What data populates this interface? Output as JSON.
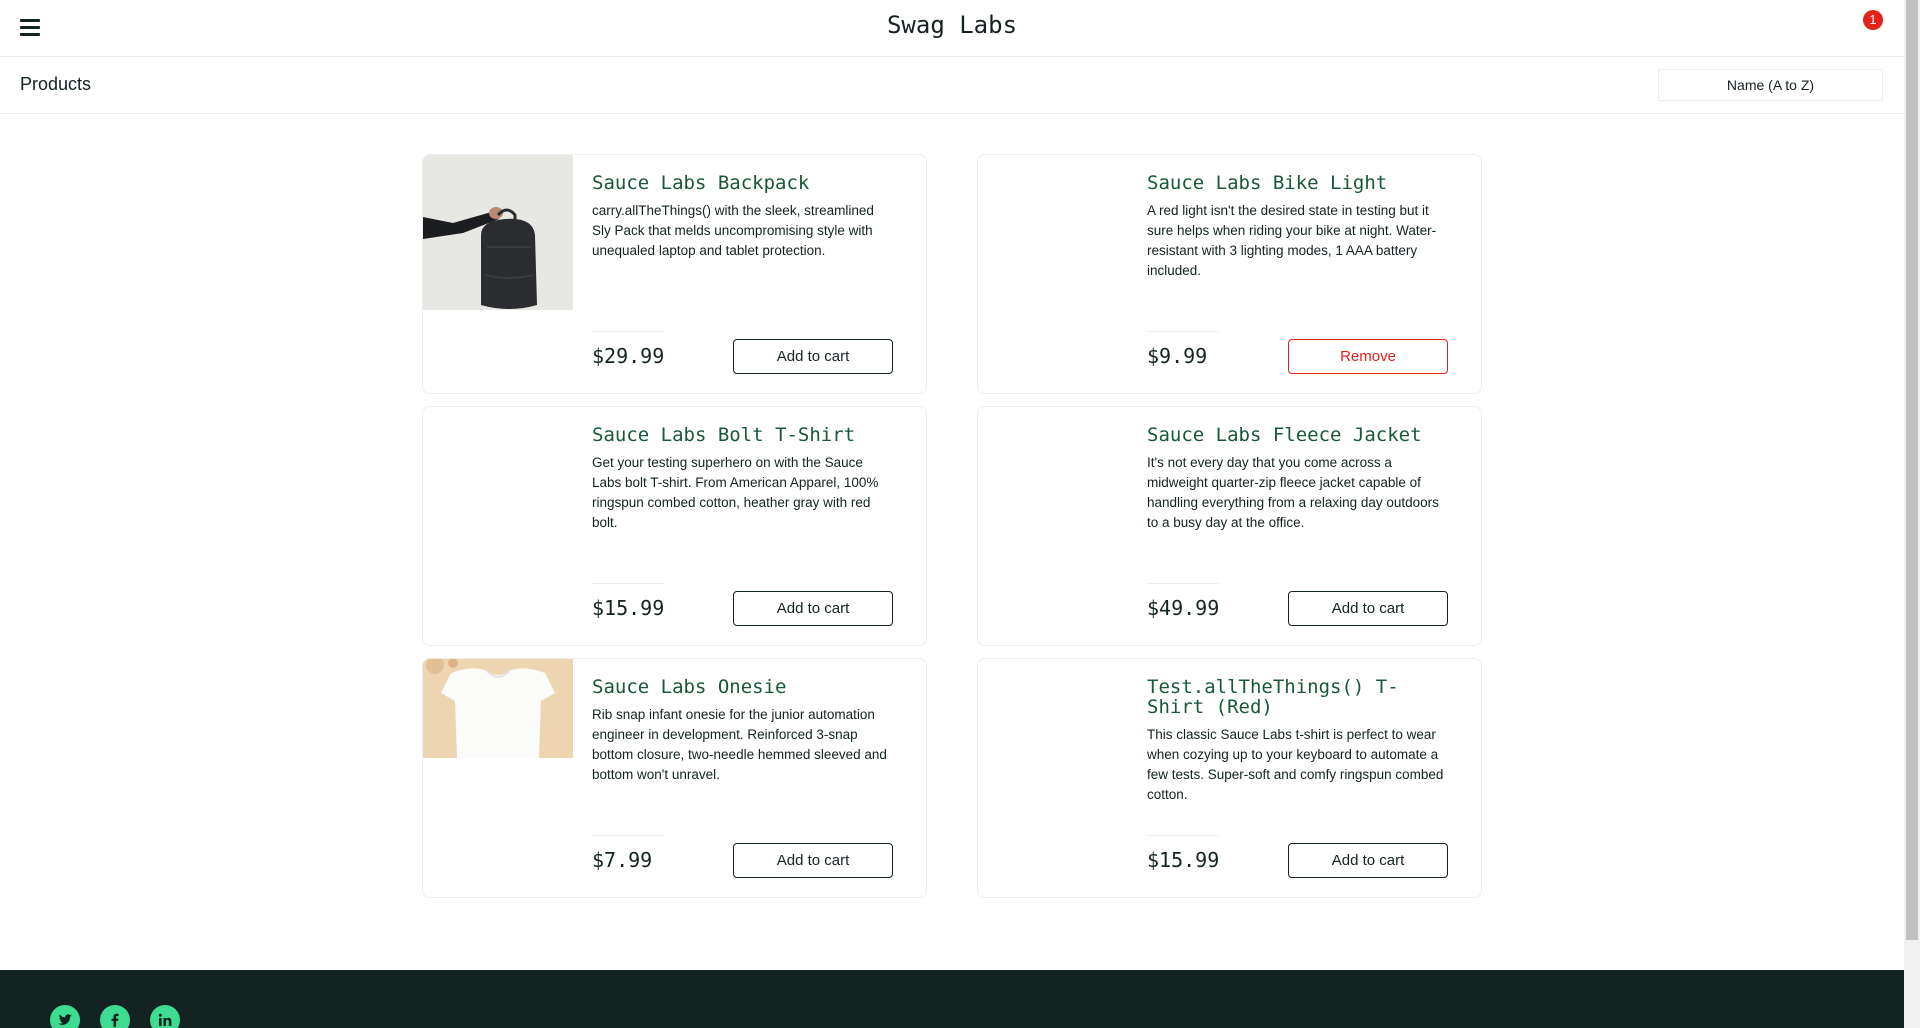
{
  "header": {
    "title": "Swag Labs",
    "cart_count": "1"
  },
  "secondary": {
    "title": "Products",
    "sort_selected": "Name (A to Z)"
  },
  "products": [
    {
      "name": "Sauce Labs Backpack",
      "description": "carry.allTheThings() with the sleek, streamlined Sly Pack that melds uncompromising style with unequaled laptop and tablet protection.",
      "price": "$29.99",
      "button": "Add to cart"
    },
    {
      "name": "Sauce Labs Bike Light",
      "description": "A red light isn't the desired state in testing but it sure helps when riding your bike at night. Water-resistant with 3 lighting modes, 1 AAA battery included.",
      "price": "$9.99",
      "button": "Remove"
    },
    {
      "name": "Sauce Labs Bolt T-Shirt",
      "description": "Get your testing superhero on with the Sauce Labs bolt T-shirt. From American Apparel, 100% ringspun combed cotton, heather gray with red bolt.",
      "price": "$15.99",
      "button": "Add to cart"
    },
    {
      "name": "Sauce Labs Fleece Jacket",
      "description": "It's not every day that you come across a midweight quarter-zip fleece jacket capable of handling everything from a relaxing day outdoors to a busy day at the office.",
      "price": "$49.99",
      "button": "Add to cart"
    },
    {
      "name": "Sauce Labs Onesie",
      "description": "Rib snap infant onesie for the junior automation engineer in development. Reinforced 3-snap bottom closure, two-needle hemmed sleeved and bottom won't unravel.",
      "price": "$7.99",
      "button": "Add to cart"
    },
    {
      "name": "Test.allTheThings() T-Shirt (Red)",
      "description": "This classic Sauce Labs t-shirt is perfect to wear when cozying up to your keyboard to automate a few tests. Super-soft and comfy ringspun combed cotton.",
      "price": "$15.99",
      "button": "Add to cart"
    }
  ],
  "footer": {
    "social": [
      "twitter-icon",
      "facebook-icon",
      "linkedin-icon"
    ]
  },
  "colors": {
    "accent_green": "#18583a",
    "badge_red": "#e2231a",
    "footer_bg": "#132322",
    "social_green": "#3ddc91"
  }
}
